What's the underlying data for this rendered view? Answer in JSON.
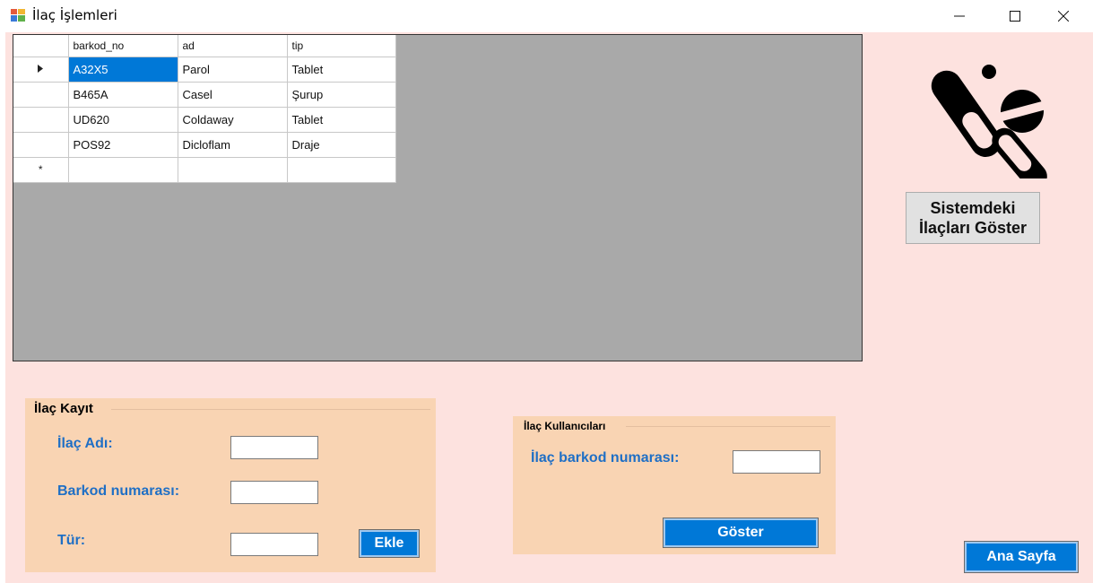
{
  "window": {
    "title": "İlaç İşlemleri"
  },
  "grid": {
    "columns": [
      "barkod_no",
      "ad",
      "tip"
    ],
    "rows": [
      [
        "A32X5",
        "Parol",
        "Tablet"
      ],
      [
        "B465A",
        "Casel",
        "Şurup"
      ],
      [
        "UD620",
        "Coldaway",
        "Tablet"
      ],
      [
        "POS92",
        "Dicloflam",
        "Draje"
      ]
    ],
    "new_row_marker": "*"
  },
  "show_all_button": {
    "line1": "Sistemdeki",
    "line2": "İlaçları Göster"
  },
  "ilac_kayit": {
    "title": "İlaç Kayıt",
    "name_label": "İlaç Adı:",
    "barcode_label": "Barkod numarası:",
    "type_label": "Tür:",
    "add_button": "Ekle"
  },
  "ilac_kullanicilari": {
    "title": "İlaç Kullanıcıları",
    "barcode_label": "İlaç barkod numarası:",
    "show_button": "Göster"
  },
  "home_button": "Ana Sayfa",
  "colors": {
    "background": "#fde2df",
    "group_background": "#f9d4b3",
    "accent": "#0078d7",
    "label_blue": "#1f6fc5",
    "grid_background": "#a9a9a9"
  }
}
